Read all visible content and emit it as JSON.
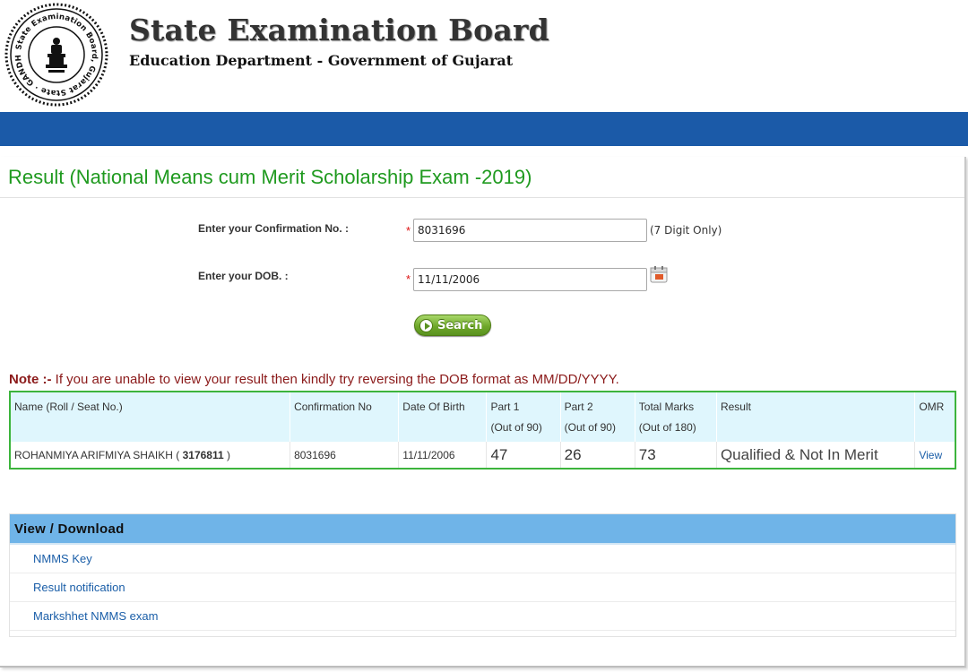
{
  "header": {
    "logo_text": "State Examination Board, Gujarat State, GANDHINAGAR",
    "title": "State Examination Board",
    "subtitle": "Education Department - Government of Gujarat"
  },
  "page": {
    "title": "Result (National Means cum Merit Scholarship Exam -2019)"
  },
  "form": {
    "confirmation_label": "Enter your Confirmation No. :",
    "confirmation_value": "8031696",
    "confirmation_hint": "(7 Digit Only)",
    "dob_label": "Enter your DOB. :",
    "dob_value": "11/11/2006",
    "required_mark": "*",
    "search_label": "Search"
  },
  "note": {
    "prefix": "Note :-",
    "text": " If you are unable to view your result then kindly try reversing the DOB format as MM/DD/YYYY."
  },
  "result_table": {
    "headers": [
      {
        "line1": "Name (Roll / Seat No.)",
        "line2": ""
      },
      {
        "line1": "Confirmation No",
        "line2": ""
      },
      {
        "line1": "Date Of Birth",
        "line2": ""
      },
      {
        "line1": "Part 1",
        "line2": "(Out of 90)"
      },
      {
        "line1": "Part 2",
        "line2": "(Out of 90)"
      },
      {
        "line1": "Total Marks",
        "line2": "(Out of 180)"
      },
      {
        "line1": "Result",
        "line2": ""
      },
      {
        "line1": "OMR",
        "line2": ""
      }
    ],
    "row": {
      "name": "ROHANMIYA ARIFMIYA SHAIKH",
      "name_open": " ( ",
      "seat_no": "3176811",
      "name_close": " )",
      "confirmation_no": "8031696",
      "dob": "11/11/2006",
      "part1": "47",
      "part2": "26",
      "total": "73",
      "result": "Qualified & Not In Merit",
      "omr": "View"
    }
  },
  "view_download": {
    "title": "View / Download",
    "items": [
      "NMMS Key",
      "Result notification",
      "Markshhet NMMS exam"
    ]
  },
  "colors": {
    "brand_blue": "#1b5aa8",
    "title_green": "#1f9a1f",
    "table_border": "#3cb43c",
    "link": "#1a5ea8"
  }
}
